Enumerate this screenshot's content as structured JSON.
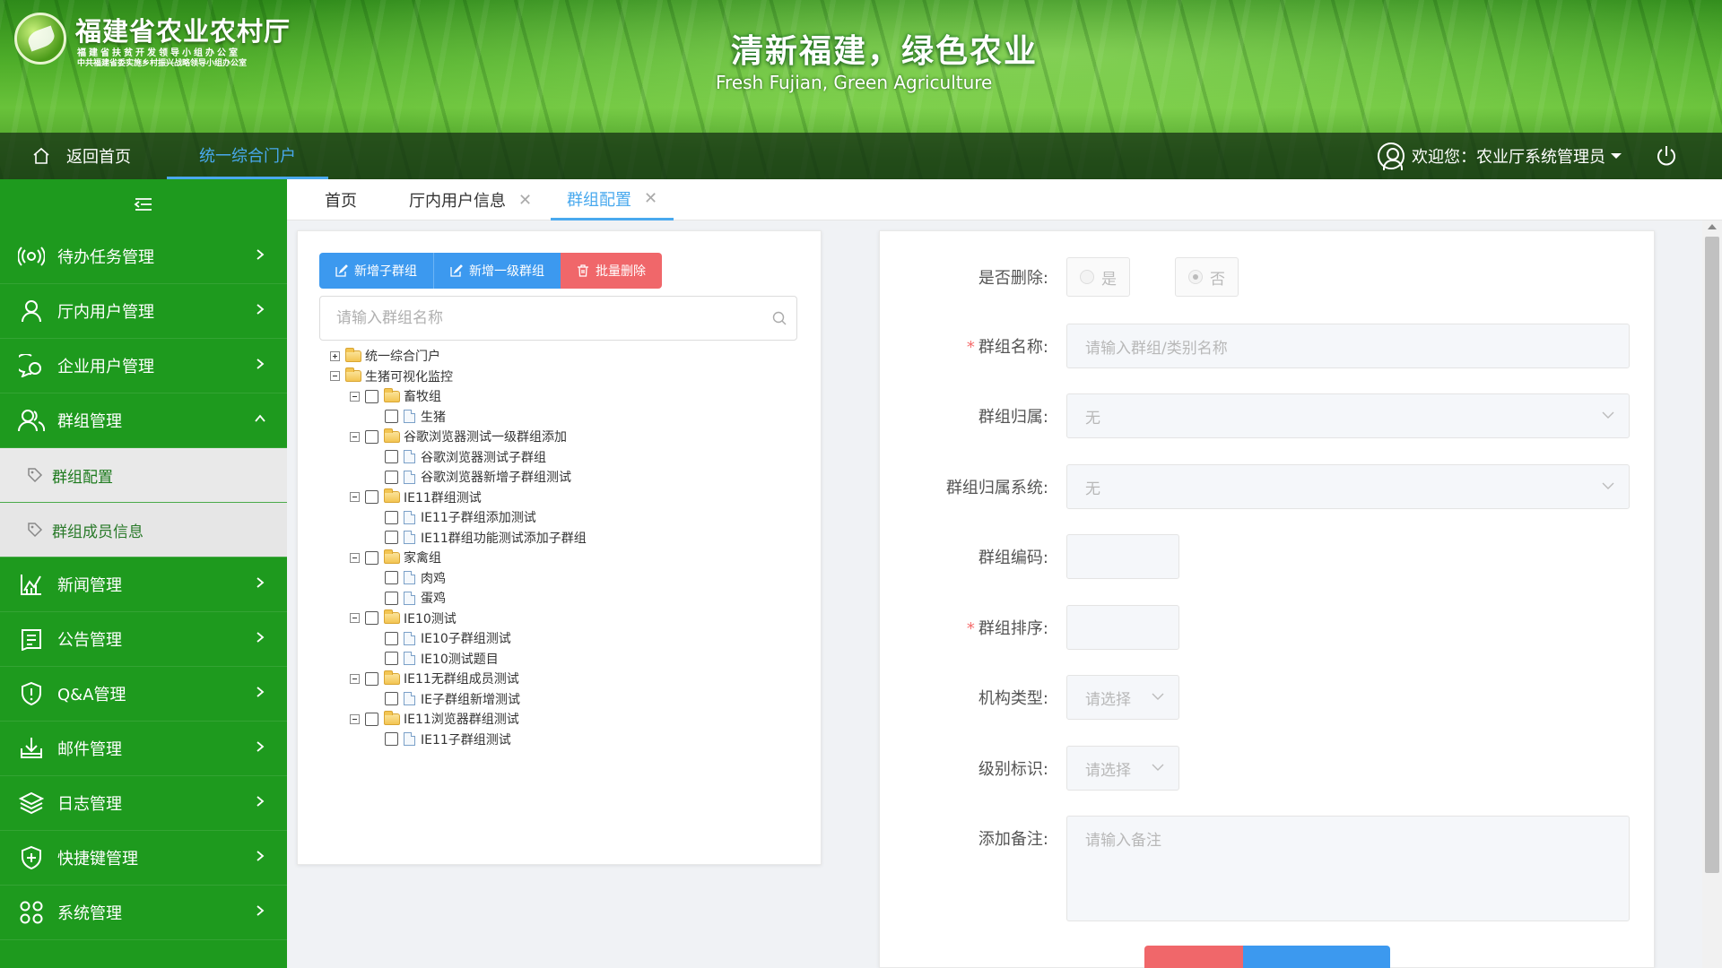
{
  "brand": {
    "title": "福建省农业农村厅",
    "sub1": "福建省扶贫开发领导小组办公室",
    "sub2": "中共福建省委实施乡村振兴战略领导小组办公室",
    "slogan_cn": "清新福建，绿色农业",
    "slogan_en": "Fresh Fujian, Green Agriculture"
  },
  "nav": {
    "home_label": "返回首页",
    "portal_label": "统一综合门户",
    "user_label": "欢迎您：农业厅系统管理员"
  },
  "sidebar": {
    "items": [
      {
        "label": "待办任务管理",
        "icon": "broadcast-icon"
      },
      {
        "label": "厅内用户管理",
        "icon": "user-icon"
      },
      {
        "label": "企业用户管理",
        "icon": "chat-icon"
      },
      {
        "label": "群组管理",
        "icon": "group-icon",
        "expanded": true
      },
      {
        "label": "新闻管理",
        "icon": "chart-icon"
      },
      {
        "label": "公告管理",
        "icon": "notice-icon"
      },
      {
        "label": "Q&A管理",
        "icon": "shield-alert-icon"
      },
      {
        "label": "邮件管理",
        "icon": "download-icon"
      },
      {
        "label": "日志管理",
        "icon": "layers-icon"
      },
      {
        "label": "快捷键管理",
        "icon": "shield-plus-icon"
      },
      {
        "label": "系统管理",
        "icon": "grid-icon"
      }
    ],
    "sub_items": [
      {
        "label": "群组配置",
        "active": true
      },
      {
        "label": "群组成员信息",
        "active": false
      }
    ]
  },
  "tabs": [
    {
      "label": "首页",
      "closable": false
    },
    {
      "label": "厅内用户信息",
      "closable": true
    },
    {
      "label": "群组配置",
      "closable": true,
      "active": true
    }
  ],
  "toolbar": {
    "add_child": "新增子群组",
    "add_top": "新增一级群组",
    "batch_delete": "批量删除"
  },
  "search": {
    "placeholder": "请输入群组名称"
  },
  "tree": [
    {
      "label": "统一综合门户",
      "level": 0,
      "type": "folder",
      "expand": "plus",
      "checkbox": false
    },
    {
      "label": "生猪可视化监控",
      "level": 0,
      "type": "folder",
      "expand": "minus",
      "checkbox": false
    },
    {
      "label": "畜牧组",
      "level": 1,
      "type": "folder",
      "expand": "minus",
      "checkbox": true
    },
    {
      "label": "生猪",
      "level": 2,
      "type": "doc",
      "checkbox": true
    },
    {
      "label": "谷歌浏览器测试一级群组添加",
      "level": 1,
      "type": "folder",
      "expand": "minus",
      "checkbox": true
    },
    {
      "label": "谷歌浏览器测试子群组",
      "level": 2,
      "type": "doc",
      "checkbox": true
    },
    {
      "label": "谷歌浏览器新增子群组测试",
      "level": 2,
      "type": "doc",
      "checkbox": true
    },
    {
      "label": "IE11群组测试",
      "level": 1,
      "type": "folder",
      "expand": "minus",
      "checkbox": true
    },
    {
      "label": "IE11子群组添加测试",
      "level": 2,
      "type": "doc",
      "checkbox": true
    },
    {
      "label": "IE11群组功能测试添加子群组",
      "level": 2,
      "type": "doc",
      "checkbox": true
    },
    {
      "label": "家禽组",
      "level": 1,
      "type": "folder",
      "expand": "minus",
      "checkbox": true
    },
    {
      "label": "肉鸡",
      "level": 2,
      "type": "doc",
      "checkbox": true
    },
    {
      "label": "蛋鸡",
      "level": 2,
      "type": "doc",
      "checkbox": true
    },
    {
      "label": "IE10测试",
      "level": 1,
      "type": "folder",
      "expand": "minus",
      "checkbox": true
    },
    {
      "label": "IE10子群组测试",
      "level": 2,
      "type": "doc",
      "checkbox": true
    },
    {
      "label": "IE10测试题目",
      "level": 2,
      "type": "doc",
      "checkbox": true
    },
    {
      "label": "IE11无群组成员测试",
      "level": 1,
      "type": "folder",
      "expand": "minus",
      "checkbox": true
    },
    {
      "label": "IE子群组新增测试",
      "level": 2,
      "type": "doc",
      "checkbox": true
    },
    {
      "label": "IE11浏览器群组测试",
      "level": 1,
      "type": "folder",
      "expand": "minus",
      "checkbox": true
    },
    {
      "label": "IE11子群组测试",
      "level": 2,
      "type": "doc",
      "checkbox": true
    }
  ],
  "form": {
    "is_deleted_label": "是否删除:",
    "yes": "是",
    "no": "否",
    "name_label": "群组名称:",
    "name_placeholder": "请输入群组/类别名称",
    "belong_label": "群组归属:",
    "belong_value": "无",
    "belong_system_label": "群组归属系统:",
    "belong_system_value": "无",
    "code_label": "群组编码:",
    "code_value": "",
    "sort_label": "群组排序:",
    "sort_value": "",
    "org_type_label": "机构类型:",
    "org_type_placeholder": "请选择",
    "level_label": "级别标识:",
    "level_placeholder": "请选择",
    "remark_label": "添加备注:",
    "remark_placeholder": "请输入备注"
  },
  "colors": {
    "sidebar_green": "#1e9a1e",
    "accent_blue": "#49a9ee",
    "button_blue": "#3c99ef",
    "button_red": "#f0676a"
  }
}
